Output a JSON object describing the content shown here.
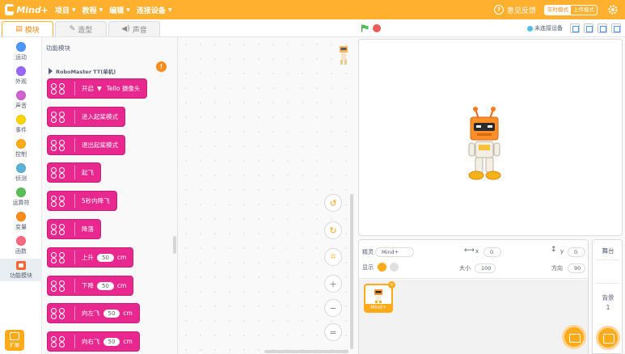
{
  "app": {
    "logo_text": "Mind+",
    "menu": [
      {
        "label": "项目"
      },
      {
        "label": "教程"
      },
      {
        "label": "编辑"
      },
      {
        "label": "连接设备"
      }
    ],
    "feedback_label": "意见反馈",
    "mode_realtime": "实时模式",
    "mode_upload": "上传模式",
    "accent_color": "#ffb02e"
  },
  "tabs": [
    {
      "label": "模块",
      "icon": "blocks-icon",
      "active": true
    },
    {
      "label": "造型",
      "icon": "brush-icon",
      "active": false
    },
    {
      "label": "声音",
      "icon": "speaker-icon",
      "active": false
    }
  ],
  "stage_toolbar": {
    "device_status": "未连接设备"
  },
  "categories": [
    {
      "label": "运动",
      "color": "#4c97ff"
    },
    {
      "label": "外观",
      "color": "#9966ff"
    },
    {
      "label": "声音",
      "color": "#cf63cf"
    },
    {
      "label": "事件",
      "color": "#ffd500"
    },
    {
      "label": "控制",
      "color": "#ffab19"
    },
    {
      "label": "侦测",
      "color": "#5cb1d6"
    },
    {
      "label": "运算符",
      "color": "#59c059"
    },
    {
      "label": "变量",
      "color": "#ff8c1a"
    },
    {
      "label": "函数",
      "color": "#ff6680"
    },
    {
      "label": "功能模块",
      "color": "#ff6633",
      "active": true
    }
  ],
  "extensions_label": "扩展",
  "palette": {
    "title": "功能模块",
    "badge": "!",
    "section": "RoboMaster TT(单机)",
    "block_color": "#e9288f",
    "blocks": [
      {
        "label": "开启",
        "dropdown": "▼",
        "suffix": "Tello 摄像头"
      },
      {
        "label": "进入起桨模式"
      },
      {
        "label": "退出起桨模式"
      },
      {
        "label": "起飞"
      },
      {
        "label": "5秒内降飞"
      },
      {
        "label": "降落"
      },
      {
        "label": "上升",
        "value": "50",
        "unit": "cm"
      },
      {
        "label": "下降",
        "value": "50",
        "unit": "cm"
      },
      {
        "label": "向左飞",
        "value": "50",
        "unit": "cm"
      },
      {
        "label": "向右飞",
        "value": "50",
        "unit": "cm"
      }
    ]
  },
  "workspace_controls": [
    {
      "name": "undo-icon",
      "glyph": "↺"
    },
    {
      "name": "redo-icon",
      "glyph": "↻"
    },
    {
      "name": "cleanup-icon",
      "glyph": "⌗"
    },
    {
      "name": "zoom-in-icon",
      "glyph": "+"
    },
    {
      "name": "zoom-out-icon",
      "glyph": "−"
    },
    {
      "name": "zoom-reset-icon",
      "glyph": "="
    }
  ],
  "sprite_info": {
    "sprite_label": "精灵",
    "sprite_name": "Mind+",
    "x_label": "x",
    "x_value": "0",
    "y_label": "y",
    "y_value": "0",
    "show_label": "显示",
    "size_label": "大小",
    "size_value": "100",
    "direction_label": "方向",
    "direction_value": "90"
  },
  "sprites": [
    {
      "name": "Mind+",
      "delete": "×"
    }
  ],
  "backdrop": {
    "title": "舞台",
    "label": "背景",
    "count": "1"
  }
}
